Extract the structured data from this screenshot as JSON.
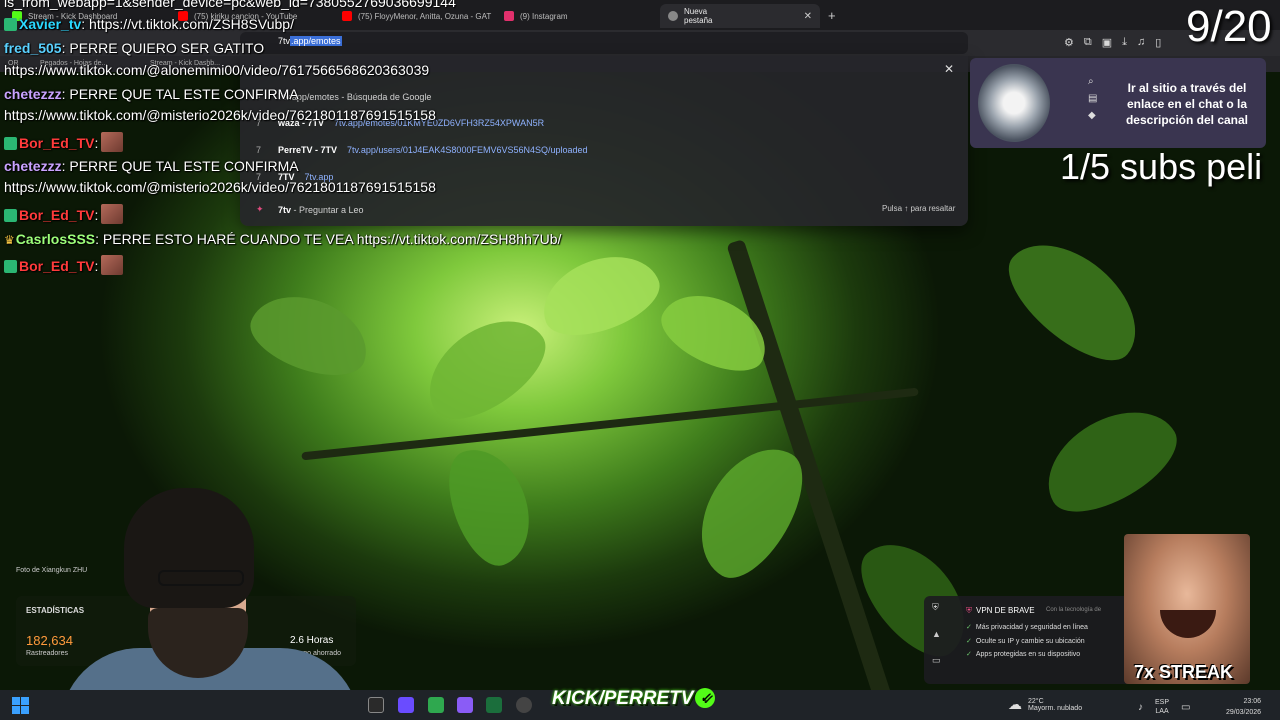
{
  "browser": {
    "tabs": [
      {
        "label": "Stream - Kick Dashboard",
        "color": "#53fc18"
      },
      {
        "label": "(75) kiriku cancion - YouTube",
        "color": "#ff0000"
      },
      {
        "label": "(75) FloyyMenor, Anitta, Ozuna - GAT",
        "color": "#ff0000"
      },
      {
        "label": "(9) Instagram",
        "color": "#e1306c"
      },
      {
        "label": "Nueva pestaña",
        "color": "#888888"
      }
    ],
    "new_tab": "+",
    "tab_close": "✕",
    "omnibox": {
      "typed": "7tv",
      "selected": ".app/emotes"
    },
    "bookmarks": [
      "OR",
      "Pegados - Hojas de...",
      "Stream - Kick Dashb..."
    ]
  },
  "suggestions": [
    {
      "icon": "search-icon",
      "text": "7tv.app/emotes",
      "suffix": " - Búsqueda de Google"
    },
    {
      "icon": "7tv-icon",
      "text": "waza - 7TV",
      "url": "7tv.app/emotes/01KMYE0ZD6VFH3RZ54XPWAN5R"
    },
    {
      "icon": "7tv-icon",
      "text": "PerreTV - 7TV",
      "url": "7tv.app/users/01J4EAK4S8000FEMV6VS56N4SQ/uploaded"
    },
    {
      "icon": "7tv-icon",
      "text": "7TV",
      "url": "7tv.app"
    },
    {
      "icon": "leo-icon",
      "text": "7tv",
      "suffix": " - Preguntar a Leo"
    }
  ],
  "dropdown_hint": "Pulsa ↑ para resaltar",
  "chat": {
    "partial": "is_from_webapp=1&sender_device=pc&web_id=7380552769036699144",
    "lines": [
      {
        "user": "Xavier_tv",
        "color": "#2bd9ff",
        "message": ": https://vt.tiktok.com/ZSH8SVubp/"
      },
      {
        "user": "fred_505",
        "color": "#5ad1ff",
        "message": ": PERRE QUIERO SER GATITO"
      },
      {
        "user": "",
        "color": "#ffffff",
        "message": "https://www.tiktok.com/@alonemimi00/video/7617566568620363039"
      },
      {
        "user": "chetezzz",
        "color": "#c9a3ff",
        "message": ": PERRE QUE TAL ESTE CONFIRMA"
      },
      {
        "user": "",
        "color": "#ffffff",
        "message": "https://www.tiktok.com/@misterio2026k/video/7621801187691515158"
      },
      {
        "user": "Bor_Ed_TV",
        "color": "#ff3b3b",
        "message": ":"
      },
      {
        "user": "chetezzz",
        "color": "#c9a3ff",
        "message": ": PERRE QUE TAL ESTE CONFIRMA"
      },
      {
        "user": "",
        "color": "#ffffff",
        "message": "https://www.tiktok.com/@misterio2026k/video/7621801187691515158"
      },
      {
        "user": "Bor_Ed_TV",
        "color": "#ff3b3b",
        "message": ":"
      },
      {
        "user": "CasrlosSSS",
        "color": "#9dff7a",
        "message": ": PERRE ESTO HARÉ CUANDO TE VEA https://vt.tiktok.com/ZSH8hh7Ub/"
      },
      {
        "user": "Bor_Ed_TV",
        "color": "#ff3b3b",
        "message": ":"
      }
    ]
  },
  "overlays": {
    "counter": "9/20",
    "promo_text": "Ir al sitio a través del enlace en el chat o la descripción del canal",
    "subs": "1/5 subs peli",
    "streak": "7x STREAK",
    "kick_brand": "KICK/PERRETV",
    "kick_check": "✓"
  },
  "stats": {
    "photo_credit": "Foto de Xiangkun ZHU",
    "title": "ESTADÍSTICAS",
    "trackers_value": "182,634",
    "trackers_label": "Rastreadores",
    "hours_value": "2.6 Horas",
    "hours_label": "tiempo ahorrado"
  },
  "vpn": {
    "title": "VPN DE BRAVE",
    "tech": "Con la tecnología de",
    "items": [
      "Más privacidad y seguridad en línea",
      "Oculte su IP y cambie su ubicación",
      "Apps protegidas en su dispositivo"
    ]
  },
  "taskbar": {
    "weather_temp": "22°C",
    "weather_desc": "Mayorm. nublado",
    "lang_top": "ESP",
    "lang_bottom": "LAA",
    "time": "23:06",
    "date": "29/03/2026"
  }
}
